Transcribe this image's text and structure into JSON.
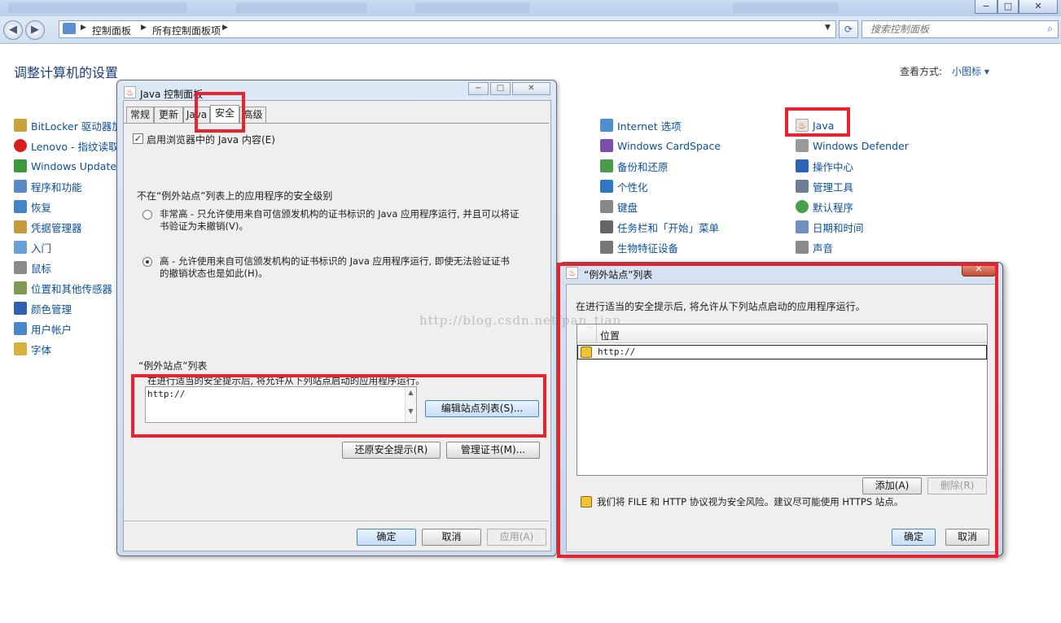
{
  "window_controls": {
    "minimize": "−",
    "maximize": "□",
    "close": "✕"
  },
  "address": {
    "back": "◀",
    "forward": "▶",
    "crumbs": [
      "控制面板",
      "所有控制面板项"
    ],
    "search_placeholder": "搜索控制面板"
  },
  "page": {
    "title": "调整计算机的设置",
    "view_by_label": "查看方式:",
    "view_by_value": "小图标 ▾"
  },
  "cp_items_left": [
    "BitLocker 驱动器加",
    "Lenovo - 指纹读取",
    "Windows Update",
    "程序和功能",
    "恢复",
    "凭据管理器",
    "入门",
    "鼠标",
    "位置和其他传感器",
    "颜色管理",
    "用户帐户",
    "字体"
  ],
  "cp_items_mid": [
    "Internet 选项",
    "Windows CardSpace",
    "备份和还原",
    "个性化",
    "键盘",
    "任务栏和「开始」菜单",
    "生物特征设备"
  ],
  "cp_items_right": [
    "Java",
    "Windows Defender",
    "操作中心",
    "管理工具",
    "默认程序",
    "日期和时间",
    "声音"
  ],
  "java_dialog": {
    "title": "Java 控制面板",
    "tabs": [
      "常规",
      "更新",
      "Java",
      "安全",
      "高级"
    ],
    "active_tab": "安全",
    "enable_browser": "启用浏览器中的 Java 内容(E)",
    "security_level_heading": "不在“例外站点”列表上的应用程序的安全级别",
    "option_very_high": "非常高 - 只允许使用来自可信颁发机构的证书标识的 Java 应用程序运行, 并且可以将证书验证为未撤销(V)。",
    "option_high": "高 - 允许使用来自可信颁发机构的证书标识的 Java 应用程序运行, 即使无法验证证书的撤销状态也是如此(H)。",
    "exception_list_heading": "“例外站点”列表",
    "exception_list_desc": "在进行适当的安全提示后, 将允许从下列站点启动的应用程序运行。",
    "exception_list_value": "http://",
    "edit_site_list": "编辑站点列表(S)...",
    "restore_prompts": "还原安全提示(R)",
    "manage_certs": "管理证书(M)...",
    "ok": "确定",
    "cancel": "取消",
    "apply": "应用(A)"
  },
  "sites_dialog": {
    "title": "“例外站点”列表",
    "description": "在进行适当的安全提示后, 将允许从下列站点启动的应用程序运行。",
    "column_location": "位置",
    "rows": [
      "http://"
    ],
    "add": "添加(A)",
    "remove": "删除(R)",
    "warning": "我们将 FILE 和 HTTP 协议视为安全风险。建议尽可能使用 HTTPS 站点。",
    "ok": "确定",
    "cancel": "取消"
  },
  "watermark": "http://blog.csdn.net/pan_tian",
  "colors": {
    "highlight_red": "#e8222e",
    "link_blue": "#0b4f9c",
    "title_blue": "#1c3c78"
  }
}
